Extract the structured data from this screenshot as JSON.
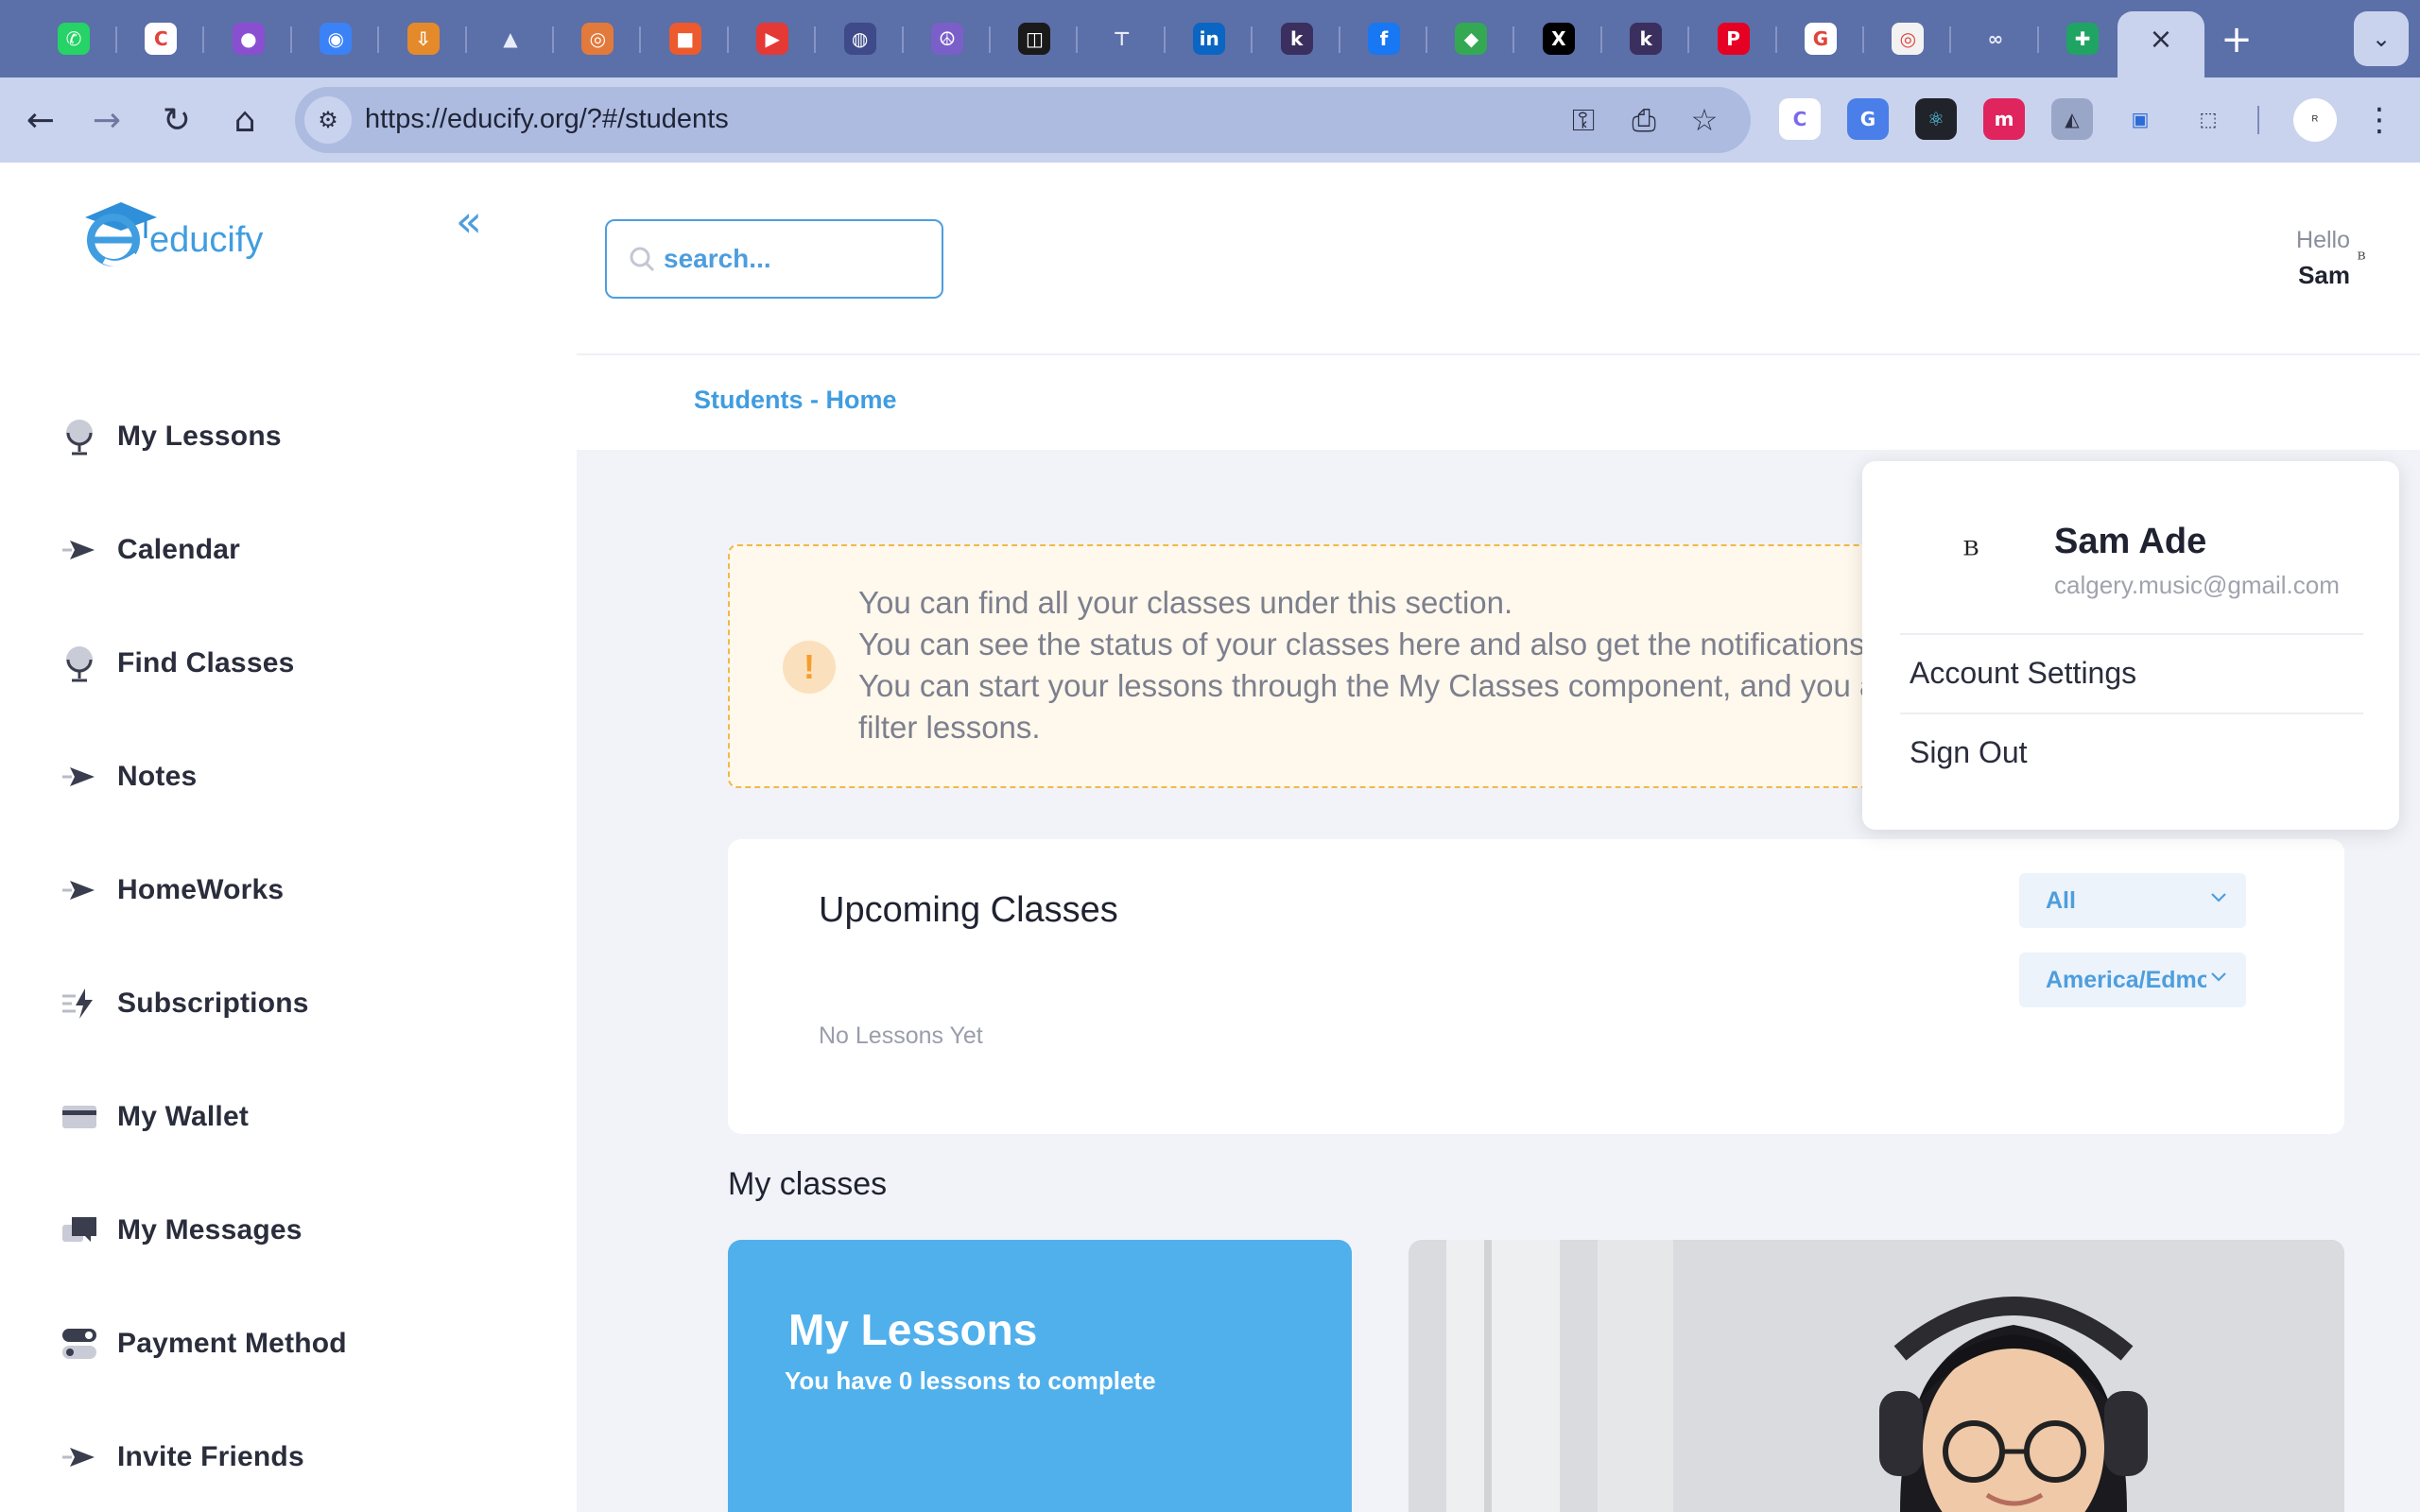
{
  "browser": {
    "tabs": [
      {
        "icon": "whatsapp-icon",
        "glyph": "✆",
        "bg": "#25d366"
      },
      {
        "icon": "clickup-icon",
        "glyph": "C",
        "bg": "#ffffff"
      },
      {
        "icon": "chat-bubble-icon",
        "glyph": "●",
        "bg": "#8a4fd1"
      },
      {
        "icon": "messenger-icon",
        "glyph": "◉",
        "bg": "#3b82f6"
      },
      {
        "icon": "shield-icon",
        "glyph": "⇩",
        "bg": "#e58a2b"
      },
      {
        "icon": "google-ads-icon",
        "glyph": "▲",
        "bg": "#5b6fa8"
      },
      {
        "icon": "orange-circle-icon",
        "glyph": "◎",
        "bg": "#e27a3c"
      },
      {
        "icon": "square-app-icon",
        "glyph": "■",
        "bg": "#ec5a2e"
      },
      {
        "icon": "youtube-icon",
        "glyph": "▶",
        "bg": "#e53935"
      },
      {
        "icon": "binoculars-icon",
        "glyph": "◍",
        "bg": "#3e4a8a"
      },
      {
        "icon": "peace-icon",
        "glyph": "☮",
        "bg": "#7b5fc9"
      },
      {
        "icon": "frame-icon",
        "glyph": "◫",
        "bg": "#1a1a1a"
      },
      {
        "icon": "notion-icon",
        "glyph": "⊤",
        "bg": "#5b6fa8"
      },
      {
        "icon": "linkedin-icon",
        "glyph": "in",
        "bg": "#0a66c2"
      },
      {
        "icon": "k-app-icon",
        "glyph": "k",
        "bg": "#3a2f5e"
      },
      {
        "icon": "facebook-icon",
        "glyph": "f",
        "bg": "#1877f2"
      },
      {
        "icon": "maps-icon",
        "glyph": "◆",
        "bg": "#34a853"
      },
      {
        "icon": "x-icon",
        "glyph": "X",
        "bg": "#000000"
      },
      {
        "icon": "k-app-icon-2",
        "glyph": "k",
        "bg": "#3a2f5e"
      },
      {
        "icon": "pinterest-icon",
        "glyph": "P",
        "bg": "#e60023"
      },
      {
        "icon": "google-icon",
        "glyph": "G",
        "bg": "#ffffff"
      },
      {
        "icon": "target-icon",
        "glyph": "◎",
        "bg": "#f2f2f2"
      },
      {
        "icon": "meta-icon",
        "glyph": "∞",
        "bg": "#5b6fa8"
      },
      {
        "icon": "sheets-plus-icon",
        "glyph": "✚",
        "bg": "#1fa463"
      }
    ],
    "url_text": "https://educify.org/?#/students",
    "extensions": [
      {
        "icon": "clickup-ext-icon",
        "glyph": "C",
        "bg": "#ffffff",
        "color": "#7b68ee"
      },
      {
        "icon": "translate-ext-icon",
        "glyph": "G",
        "bg": "#4a7ee8",
        "color": "#ffffff"
      },
      {
        "icon": "react-ext-icon",
        "glyph": "⚛",
        "bg": "#20232a",
        "color": "#61dafb"
      },
      {
        "icon": "m-ext-icon",
        "glyph": "m",
        "bg": "#e0245e",
        "color": "#ffffff"
      },
      {
        "icon": "drive-ext-icon",
        "glyph": "◭",
        "bg": "#9aa6c8",
        "color": "#2b2f45"
      },
      {
        "icon": "screen-ext-icon",
        "glyph": "▣",
        "bg": "#c9d3ee",
        "color": "#2d6bd8"
      },
      {
        "icon": "puzzle-ext-icon",
        "glyph": "⬚",
        "bg": "#c9d3ee",
        "color": "#2b2f45"
      }
    ]
  },
  "brand": {
    "name": "educify",
    "accent": "#4d9ede"
  },
  "sidebar": {
    "items": [
      {
        "label": "My Lessons",
        "icon": "lesson-icon"
      },
      {
        "label": "Calendar",
        "icon": "arrow-send-icon"
      },
      {
        "label": "Find Classes",
        "icon": "lesson-icon"
      },
      {
        "label": "Notes",
        "icon": "arrow-send-icon"
      },
      {
        "label": "HomeWorks",
        "icon": "arrow-send-icon"
      },
      {
        "label": "Subscriptions",
        "icon": "lightning-icon"
      },
      {
        "label": "My Wallet",
        "icon": "card-icon"
      },
      {
        "label": "My Messages",
        "icon": "messages-icon"
      },
      {
        "label": "Payment Method",
        "icon": "toggle-icon"
      },
      {
        "label": "Invite Friends",
        "icon": "arrow-send-icon"
      }
    ]
  },
  "header": {
    "search_placeholder": "search...",
    "hello": "Hello",
    "user_first_name": "Sam",
    "breadcrumb": "Students - Home"
  },
  "alert": {
    "lines": [
      "You can find all your classes under this section.",
      "You can see the status of your classes here and also get the notifications",
      "You can start your lessons through the My Classes component, and you also have the option to",
      "filter lessons."
    ]
  },
  "upcoming": {
    "title": "Upcoming Classes",
    "empty_text": "No Lessons Yet",
    "filter_value": "All",
    "timezone_value": "America/Edmonton"
  },
  "my_classes": {
    "heading": "My classes",
    "card_title": "My Lessons",
    "card_subtitle": "You have 0 lessons to complete"
  },
  "dropdown": {
    "name": "Sam Ade",
    "email": "calgery.music@gmail.com",
    "items": [
      "Account Settings",
      "Sign Out"
    ]
  }
}
